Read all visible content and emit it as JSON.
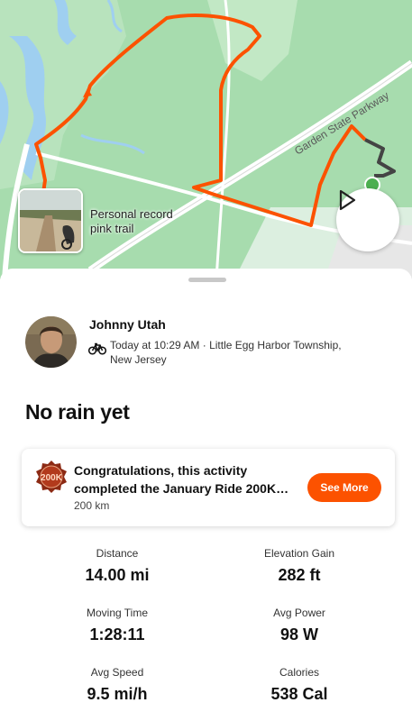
{
  "map": {
    "road_label": "Garden State Parkway",
    "photo_label_line1": "Personal record",
    "photo_label_line2": "pink trail",
    "play_icon": "play-icon"
  },
  "activity": {
    "athlete_name": "Johnny Utah",
    "meta_line1": "Today at 10:29 AM · Little Egg Harbor Township,",
    "meta_line2": "New Jersey",
    "title": "No rain yet",
    "sport_icon": "bike-icon"
  },
  "challenge": {
    "badge_text": "200K",
    "message_line1": "Congratulations, this activity",
    "message_line2": "completed the January Ride 200K…",
    "distance": "200 km",
    "button_label": "See More",
    "accent_color": "#fc5200"
  },
  "stats": [
    {
      "label": "Distance",
      "value": "14.00 mi"
    },
    {
      "label": "Elevation Gain",
      "value": "282 ft"
    },
    {
      "label": "Moving Time",
      "value": "1:28:11"
    },
    {
      "label": "Avg Power",
      "value": "98 W"
    },
    {
      "label": "Avg Speed",
      "value": "9.5 mi/h"
    },
    {
      "label": "Calories",
      "value": "538 Cal"
    }
  ]
}
